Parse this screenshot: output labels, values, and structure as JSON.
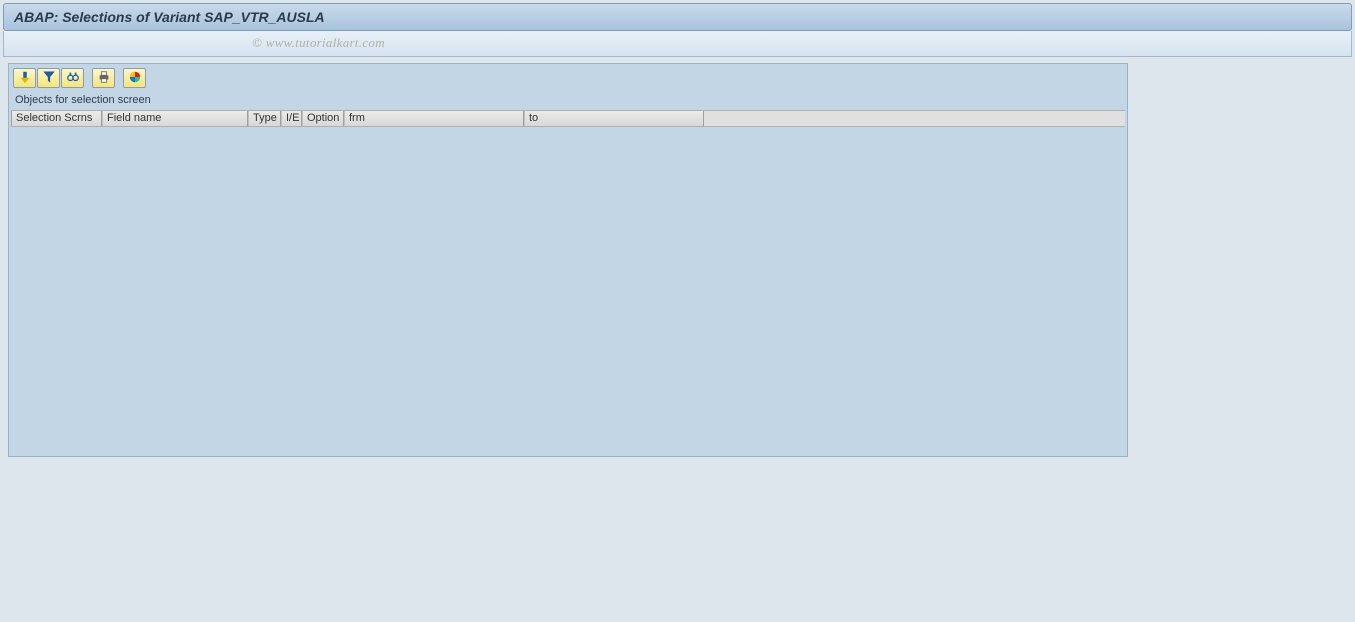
{
  "title": "ABAP: Selections of Variant SAP_VTR_AUSLA",
  "watermark": "© www.tutorialkart.com",
  "section_label": "Objects for selection screen",
  "columns": {
    "c0": "Selection Scrns",
    "c1": "Field name",
    "c2": "Type",
    "c3": "I/E",
    "c4": "Option",
    "c5": "frm",
    "c6": "to"
  },
  "toolbar": {
    "sort_asc": "Sort Ascending",
    "filter": "Filter",
    "find": "Find",
    "print": "Print",
    "colors": "Colors"
  }
}
